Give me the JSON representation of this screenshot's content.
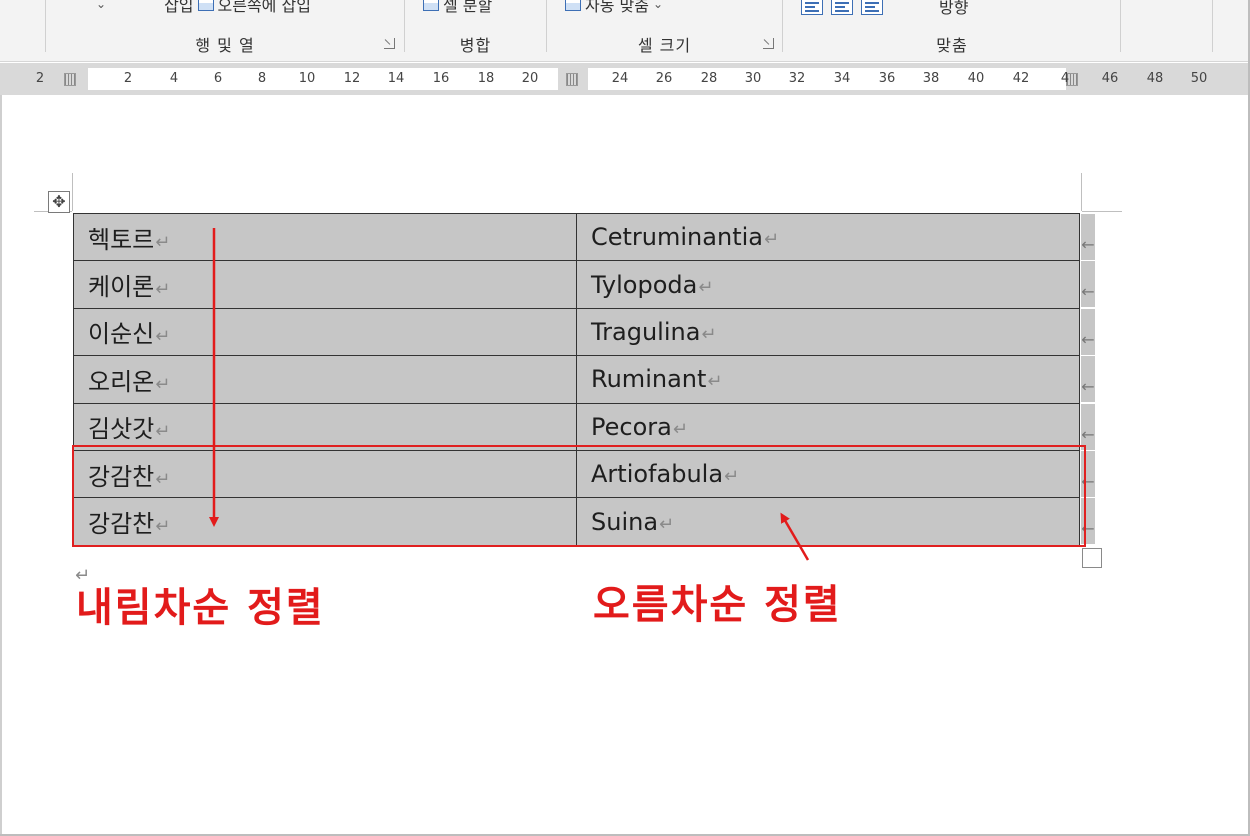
{
  "ribbon": {
    "insert_label": "삽입",
    "insert_right_label": "오른쪽에 삽입",
    "merge_split_label": "셀 분할",
    "autofit_label": "자동 맞춤",
    "direction_label": "방향",
    "groups": {
      "rows_cols": "행 및 열",
      "merge": "병합",
      "cell_size": "셀 크기",
      "alignment": "맞춤"
    }
  },
  "ruler": {
    "ticks": [
      "2",
      "2",
      "4",
      "6",
      "8",
      "10",
      "12",
      "14",
      "16",
      "18",
      "20",
      "24",
      "26",
      "28",
      "30",
      "32",
      "34",
      "36",
      "38",
      "40",
      "42",
      "4",
      "46",
      "48",
      "50"
    ]
  },
  "table": {
    "rows": [
      {
        "name": "헥토르",
        "taxon": "Cetruminantia"
      },
      {
        "name": "케이론",
        "taxon": "Tylopoda"
      },
      {
        "name": "이순신",
        "taxon": "Tragulina"
      },
      {
        "name": "오리온",
        "taxon": "Ruminant"
      },
      {
        "name": "김삿갓",
        "taxon": "Pecora"
      },
      {
        "name": "강감찬",
        "taxon": "Artiofabula"
      },
      {
        "name": "강감찬",
        "taxon": "Suina"
      }
    ],
    "cell_end_mark": "↵",
    "row_end_mark": "←"
  },
  "annotations": {
    "descending": "내림차순 정렬",
    "ascending": "오름차순 정렬",
    "color": "#e21b1b"
  }
}
